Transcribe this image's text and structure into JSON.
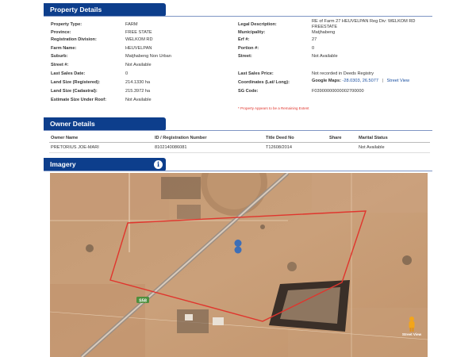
{
  "property_details": {
    "title": "Property Details",
    "left": [
      {
        "label": "Property Type:",
        "value": "FARM"
      },
      {
        "label": "Province:",
        "value": "FREE STATE"
      },
      {
        "label": "Registration Division:",
        "value": "WELKOM RD"
      },
      {
        "label": "Farm Name:",
        "value": "HEUVELPAN"
      },
      {
        "label": "Suburb:",
        "value": "Matjhabeng Non Urban"
      },
      {
        "label": "Street #:",
        "value": "Not Available"
      },
      {
        "label": "Last Sales Date:",
        "value": "0"
      },
      {
        "label": "Land Size (Registered):",
        "value": "214.1330 ha"
      },
      {
        "label": "Land Size (Cadastral):",
        "value": "215.3972 ha"
      },
      {
        "label": "Estimate Size Under Roof:",
        "value": "Not Available"
      }
    ],
    "right": [
      {
        "label": "Legal Description:",
        "value": "RE of Farm 27 HEUVELPAN Reg Div: WELKOM RD FREESTATE"
      },
      {
        "label": "Municipality:",
        "value": "Matjhabeng"
      },
      {
        "label": "Erf #:",
        "value": "27"
      },
      {
        "label": "Portion #:",
        "value": "0"
      },
      {
        "label": "Street:",
        "value": "Not Available"
      },
      {
        "label": "Last Sales Price:",
        "value": "Not recorded in Deeds Registry"
      },
      {
        "label": "Coordinates (Lat/ Long):",
        "value": ""
      },
      {
        "label": "SG Code:",
        "value": "F03900000000002700000"
      }
    ],
    "coordinates": {
      "prefix": "Google Maps:",
      "value": "-28.0303, 26.5077",
      "separator": "|",
      "street_view": "Street View"
    },
    "note": "* Property Appears to be a Remaining Extent"
  },
  "owner_details": {
    "title": "Owner Details",
    "columns": [
      "Owner Name",
      "ID / Registration Number",
      "Title Deed No",
      "Share",
      "Marital Status"
    ],
    "rows": [
      [
        "PRETORIUS JOE-MARI",
        "8102140086081",
        "T12608/2014",
        "",
        "Not Available"
      ]
    ]
  },
  "imagery": {
    "title": "Imagery",
    "info_icon": "i",
    "road_sign": "S58",
    "street_view_label": "Street View",
    "colors": {
      "ground": "#c79a73",
      "parcel_outline": "#e0352d",
      "pin": "#3d6fb8"
    }
  },
  "colors": {
    "header_bg": "#0d3e8c",
    "note_red": "#e0352d",
    "link_blue": "#1a4fa0"
  }
}
